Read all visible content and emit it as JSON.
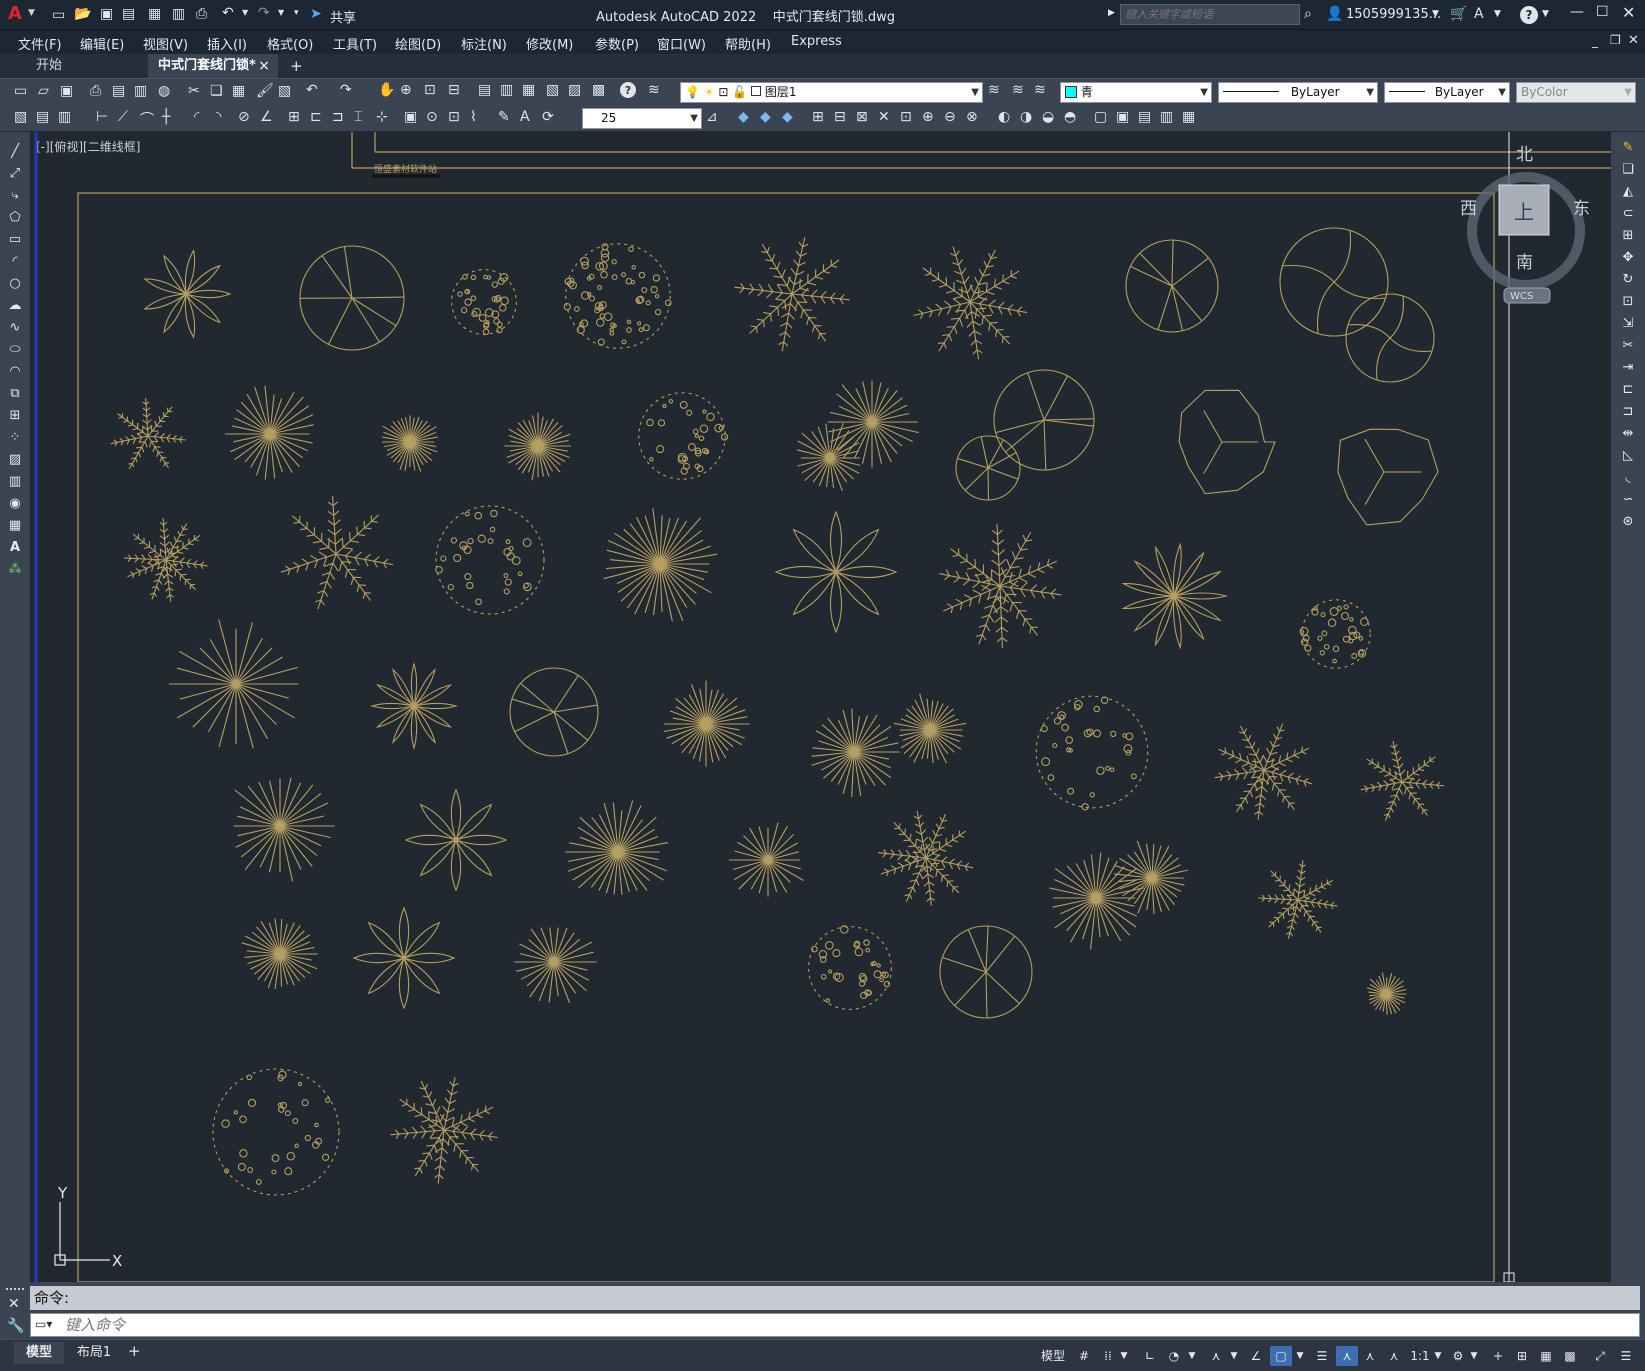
{
  "titlebar": {
    "app_logo": "A",
    "share_label": "共享",
    "title": "Autodesk AutoCAD 2022    中式门套线门锁.dwg",
    "search_placeholder": "键入关键字或短语",
    "user": "1505999135...",
    "icons": [
      "new-icon",
      "open-icon",
      "save-icon",
      "saveas-icon",
      "plot-icon",
      "undo-icon",
      "redo-icon",
      "share-icon",
      "cart-icon",
      "help-icon",
      "minimize-icon",
      "maximize-icon",
      "close-icon"
    ]
  },
  "menu": [
    "文件(F)",
    "编辑(E)",
    "视图(V)",
    "插入(I)",
    "格式(O)",
    "工具(T)",
    "绘图(D)",
    "标注(N)",
    "修改(M)",
    "参数(P)",
    "窗口(W)",
    "帮助(H)",
    "Express"
  ],
  "tabs": {
    "start": "开始",
    "active": "中式门套线门锁*",
    "close_glyph": "×",
    "add_glyph": "+"
  },
  "toolbar": {
    "layer_name": "图层1",
    "color_name": "青",
    "color_swatch": "#00ffff",
    "linetype": "ByLayer",
    "lineweight": "ByLayer",
    "plotstyle": "ByColor",
    "text_height": "25"
  },
  "viewport": {
    "label": "[-][俯视][二维线框]",
    "stamp": "恒盛素材软件站",
    "drawing_color": "#b59f62",
    "viewcube": {
      "north": "北",
      "south": "南",
      "east": "东",
      "west": "西",
      "top": "上",
      "wcs": "WCS"
    },
    "ucs": {
      "x": "X",
      "y": "Y"
    }
  },
  "command": {
    "history": "命令:",
    "placeholder": "键入命令"
  },
  "status": {
    "layout_tabs": [
      "模型",
      "布局1"
    ],
    "add_glyph": "+",
    "model_label": "模型",
    "scale": "1:1"
  }
}
